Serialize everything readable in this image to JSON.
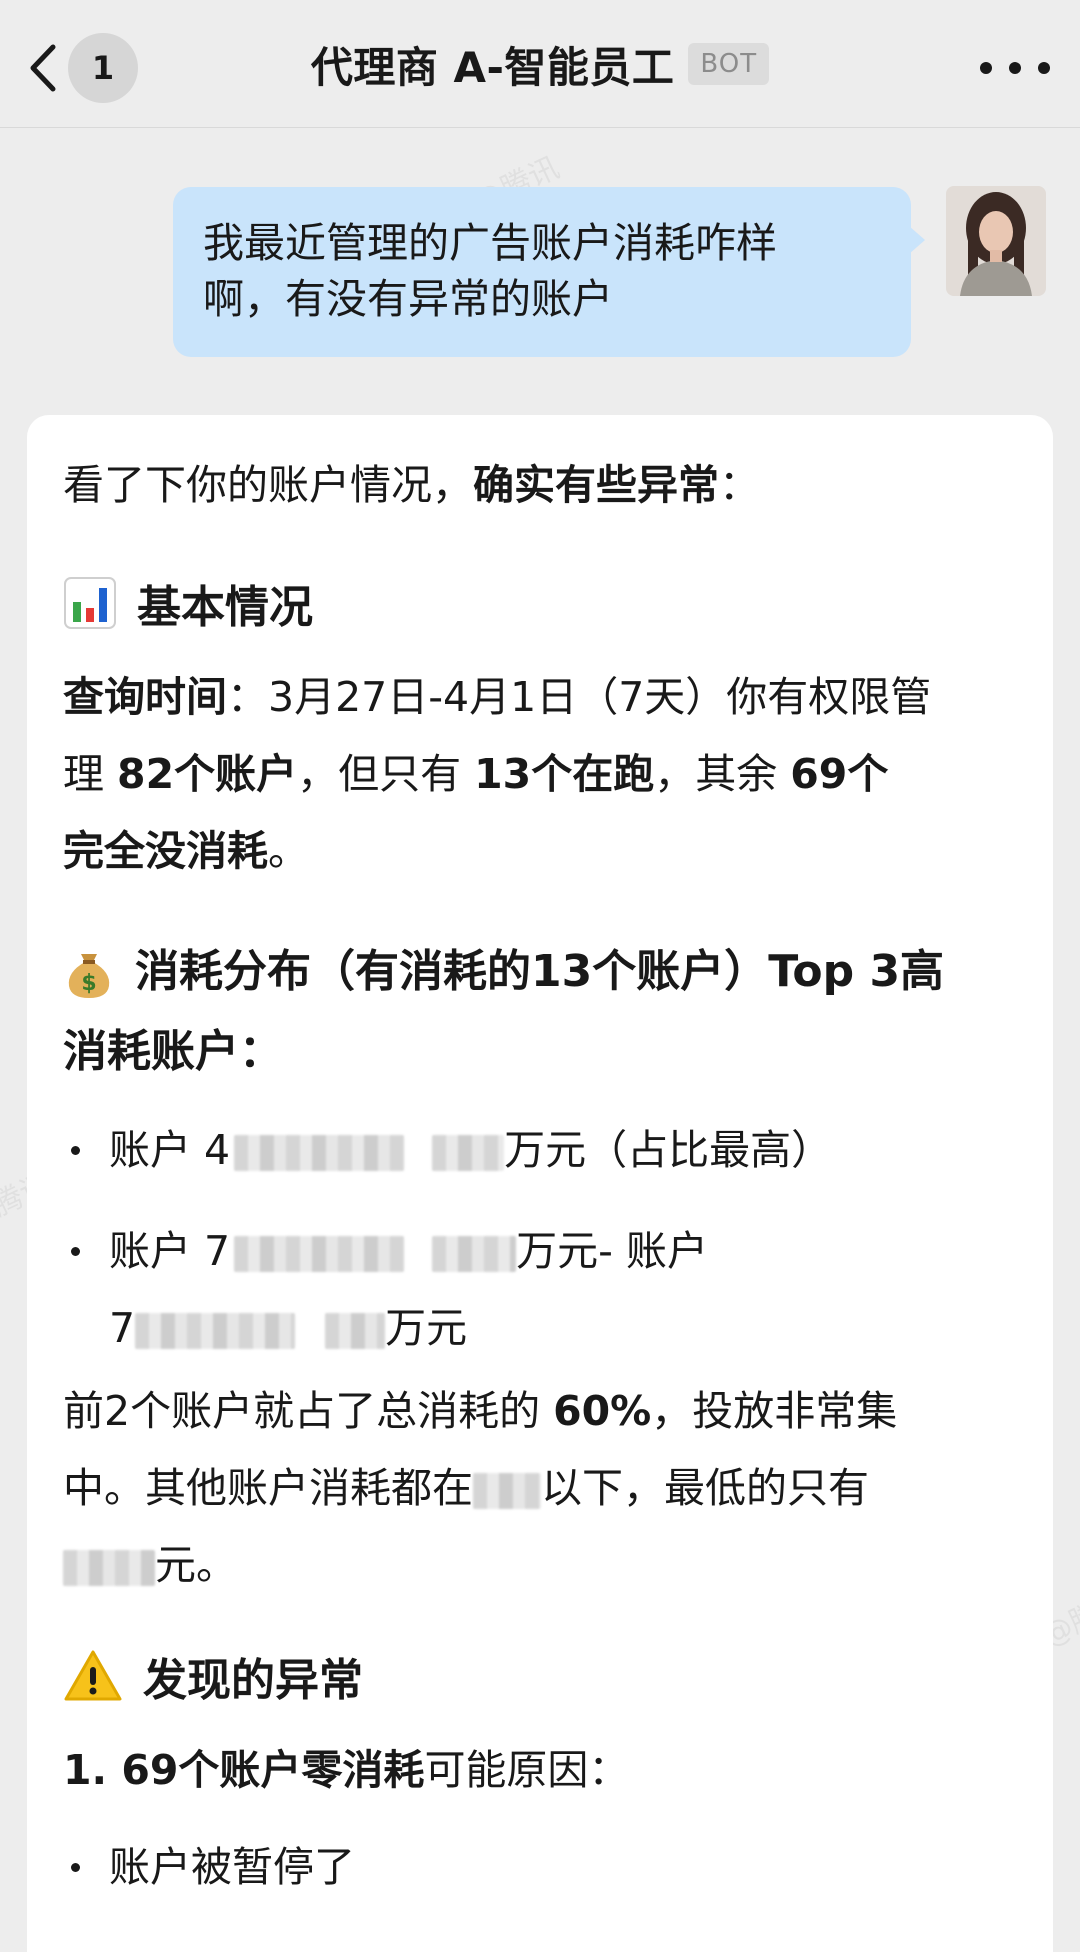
{
  "header": {
    "back_icon": "chevron-left-icon",
    "unread_count": "1",
    "title": "代理商 A-智能员工",
    "bot_tag": "BOT",
    "more_icon": "more-dots-icon"
  },
  "watermark": {
    "text_1": "@腾讯",
    "text_2": "腾讯",
    "text_3": "@腾"
  },
  "user_message": {
    "line_1": "我最近管理的广告账户消耗咋样",
    "line_2": "啊，有没有异常的账户"
  },
  "bot_message": {
    "intro_plain": "看了下你的账户情况，",
    "intro_bold": "确实有些异常",
    "intro_end": "：",
    "section_basic": {
      "icon": "bar-chart-icon",
      "title": "基本情况",
      "label": "查询时间",
      "t1": "：3月27日-4月1日（7天）你有权限管",
      "t2a": "理 ",
      "t2b": "82个账户",
      "t2c": "，但只有 ",
      "t2d": "13个在跑",
      "t2e": "，其余 ",
      "t2f": "69个",
      "t3a": "完全没消耗",
      "t3b": "。"
    },
    "section_spend": {
      "icon": "money-bag-icon",
      "title_line1": "消耗分布（有消耗的13个账户）Top 3高",
      "title_line2": "消耗账户：",
      "b1_prefix": "账户 4",
      "b1_suffix": "万元（占比最高）",
      "b2_prefix": "账户 7",
      "b2_suffix": "万元- 账户",
      "b3_prefix": "7",
      "b3_suffix": "万元",
      "p1a": "前2个账户就占了总消耗的 ",
      "p1b": "60%",
      "p1c": "，投放非常集",
      "p2a": "中。其他账户消耗都在",
      "p2b": "以下，最低的只有",
      "p3": "元。"
    },
    "section_anomaly": {
      "icon": "warning-icon",
      "title": "发现的异常",
      "item1_bold": "1. 69个账户零消耗",
      "item1_rest": "可能原因：",
      "bullet1": "账户被暂停了"
    }
  },
  "colors": {
    "background": "#ededed",
    "user_bubble": "#c9e4fb",
    "card": "#ffffff",
    "text": "#191919"
  }
}
